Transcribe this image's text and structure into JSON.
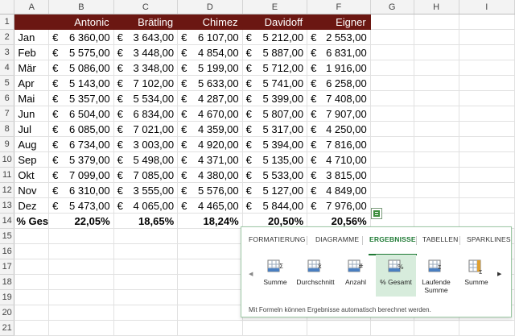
{
  "sheet": {
    "column_letters": [
      "A",
      "B",
      "C",
      "D",
      "E",
      "F",
      "G",
      "H",
      "I"
    ],
    "header_row": {
      "row_number": "1",
      "cells": [
        "",
        "Antonic",
        "Brätling",
        "Chimez",
        "Davidoff",
        "Eigner"
      ]
    },
    "currency_symbol": "€",
    "rows": [
      {
        "n": "2",
        "month": "Jan",
        "values": [
          "6 360,00",
          "3 643,00",
          "6 107,00",
          "5 212,00",
          "2 553,00"
        ]
      },
      {
        "n": "3",
        "month": "Feb",
        "values": [
          "5 575,00",
          "3 448,00",
          "4 854,00",
          "5 887,00",
          "6 831,00"
        ]
      },
      {
        "n": "4",
        "month": "Mär",
        "values": [
          "5 086,00",
          "3 348,00",
          "5 199,00",
          "5 712,00",
          "1 916,00"
        ]
      },
      {
        "n": "5",
        "month": "Apr",
        "values": [
          "5 143,00",
          "7 102,00",
          "5 633,00",
          "5 741,00",
          "6 258,00"
        ]
      },
      {
        "n": "6",
        "month": "Mai",
        "values": [
          "5 357,00",
          "5 534,00",
          "4 287,00",
          "5 399,00",
          "7 408,00"
        ]
      },
      {
        "n": "7",
        "month": "Jun",
        "values": [
          "6 504,00",
          "6 834,00",
          "4 670,00",
          "5 807,00",
          "7 907,00"
        ]
      },
      {
        "n": "8",
        "month": "Jul",
        "values": [
          "6 085,00",
          "7 021,00",
          "4 359,00",
          "5 317,00",
          "4 250,00"
        ]
      },
      {
        "n": "9",
        "month": "Aug",
        "values": [
          "6 734,00",
          "3 003,00",
          "4 920,00",
          "5 394,00",
          "7 816,00"
        ]
      },
      {
        "n": "10",
        "month": "Sep",
        "values": [
          "5 379,00",
          "5 498,00",
          "4 371,00",
          "5 135,00",
          "4 710,00"
        ]
      },
      {
        "n": "11",
        "month": "Okt",
        "values": [
          "7 099,00",
          "7 085,00",
          "4 380,00",
          "5 533,00",
          "3 815,00"
        ]
      },
      {
        "n": "12",
        "month": "Nov",
        "values": [
          "6 310,00",
          "3 555,00",
          "5 576,00",
          "5 127,00",
          "4 849,00"
        ]
      },
      {
        "n": "13",
        "month": "Dez",
        "values": [
          "5 473,00",
          "4 065,00",
          "4 465,00",
          "5 844,00",
          "7 976,00"
        ]
      }
    ],
    "total_row": {
      "n": "14",
      "label": "% Ges",
      "values": [
        "22,05%",
        "18,65%",
        "18,24%",
        "20,50%",
        "20,56%"
      ]
    },
    "empty_rows": [
      "15",
      "16",
      "17",
      "18",
      "19",
      "20",
      "21"
    ],
    "header_color": "#6b1712"
  },
  "quick_analysis": {
    "tabs": [
      "FORMATIERUNG",
      "DIAGRAMME",
      "ERGEBNISSE",
      "TABELLEN",
      "SPARKLINES"
    ],
    "active_tab": "ERGEBNISSE",
    "items": [
      {
        "label": "Summe",
        "icon": "sum-rows-icon"
      },
      {
        "label": "Durchschnitt",
        "icon": "average-icon"
      },
      {
        "label": "Anzahl",
        "icon": "count-icon"
      },
      {
        "label": "% Gesamt",
        "icon": "percent-total-icon"
      },
      {
        "label": "Laufende Summe",
        "icon": "running-total-icon"
      },
      {
        "label": "Summe",
        "icon": "sum-columns-icon"
      }
    ],
    "selected_item": "% Gesamt",
    "hint": "Mit Formeln können Ergebnisse automatisch berechnet werden.",
    "accent_color": "#1f7a35"
  }
}
